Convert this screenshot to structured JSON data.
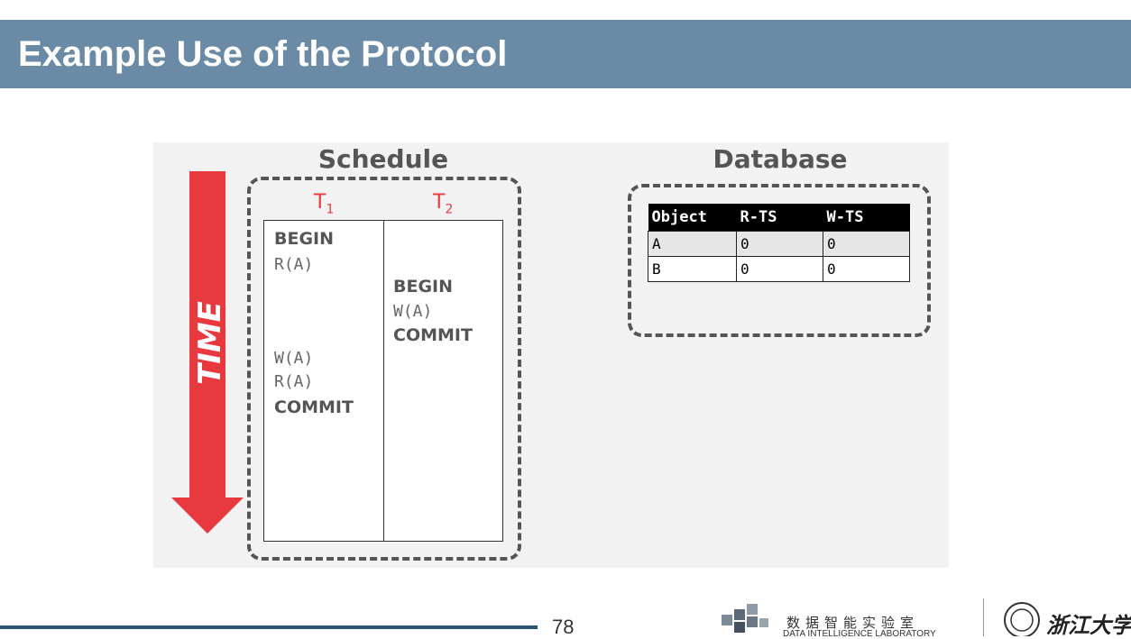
{
  "slide": {
    "title": "Example Use of the Protocol",
    "page_number": "78"
  },
  "time_arrow": {
    "label": "TIME",
    "color": "#e8393e"
  },
  "schedule": {
    "heading": "Schedule",
    "t1_label": "T",
    "t1_sub": "1",
    "t2_label": "T",
    "t2_sub": "2",
    "t1_ops": [
      "BEGIN",
      "R(A)",
      "W(A)",
      "R(A)",
      "COMMIT"
    ],
    "t2_ops": [
      "BEGIN",
      "W(A)",
      "COMMIT"
    ]
  },
  "database": {
    "heading": "Database",
    "columns": [
      "Object",
      "R-TS",
      "W-TS"
    ],
    "rows": [
      [
        "A",
        "0",
        "0"
      ],
      [
        "B",
        "0",
        "0"
      ]
    ]
  },
  "footer": {
    "lab_name_cn": "数据智能实验室",
    "lab_name_en": "DATA INTELLIGENCE LABORATORY",
    "university_cn": "浙江大学"
  },
  "colors": {
    "title_bar": "#6a8aa6",
    "accent_red": "#e8393e",
    "footer_line": "#2f5474"
  }
}
